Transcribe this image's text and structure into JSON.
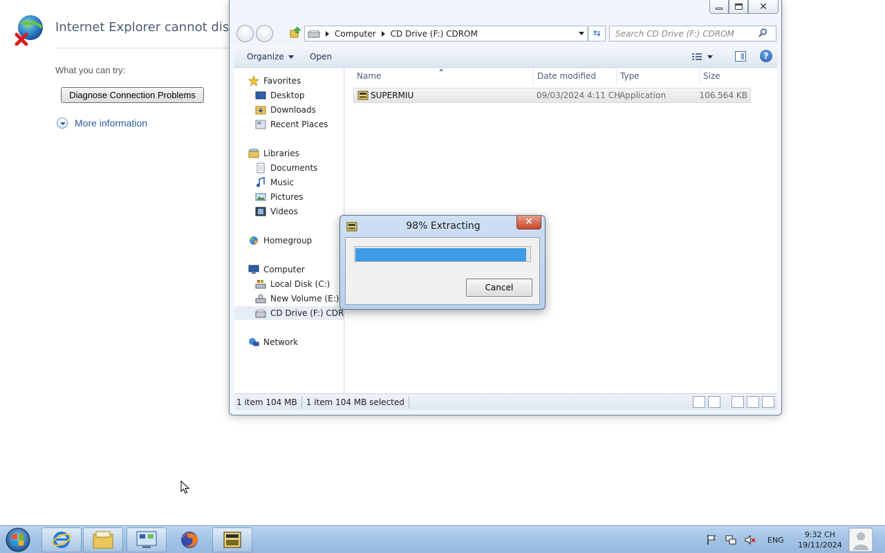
{
  "ie_page": {
    "title": "Internet Explorer cannot display",
    "try_label": "What you can try:",
    "diagnose_button": "Diagnose Connection Problems",
    "more_info": "More information"
  },
  "explorer": {
    "breadcrumb": [
      "Computer",
      "CD Drive (F:) CDROM"
    ],
    "search_placeholder": "Search CD Drive (F:) CDROM",
    "toolbar": {
      "organize": "Organize",
      "open": "Open"
    },
    "nav": {
      "favorites": "Favorites",
      "desktop": "Desktop",
      "downloads": "Downloads",
      "recent": "Recent Places",
      "libraries": "Libraries",
      "documents": "Documents",
      "music": "Music",
      "pictures": "Pictures",
      "videos": "Videos",
      "homegroup": "Homegroup",
      "computer": "Computer",
      "local_disk": "Local Disk (C:)",
      "new_volume": "New Volume (E:)",
      "cd_drive": "CD Drive (F:) CDROM",
      "network": "Network"
    },
    "columns": {
      "name": "Name",
      "date": "Date modified",
      "type": "Type",
      "size": "Size"
    },
    "files": [
      {
        "name": "SUPERMIU",
        "date": "09/03/2024 4:11 CH",
        "type": "Application",
        "size": "106.564 KB"
      }
    ],
    "status": {
      "items": "1 item 104 MB",
      "selected": "1 item 104 MB selected"
    }
  },
  "dialog": {
    "title": "98% Extracting",
    "progress": 0.98,
    "cancel": "Cancel",
    "close": "✕"
  },
  "taskbar": {
    "lang": "ENG",
    "time": "9:32 CH",
    "date": "19/11/2024"
  }
}
